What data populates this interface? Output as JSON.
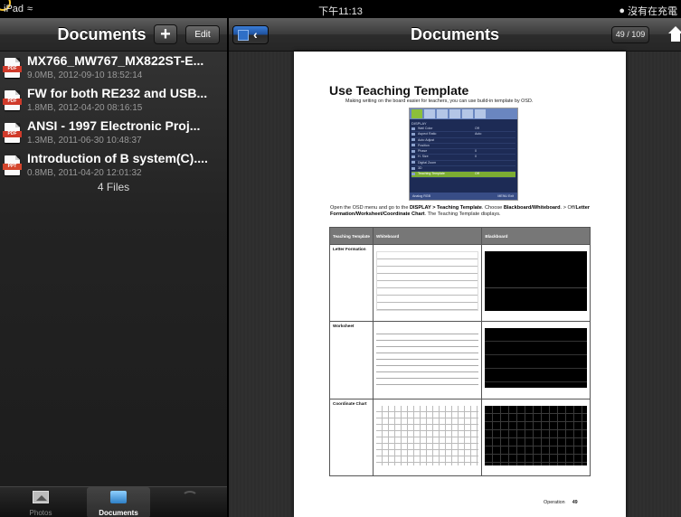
{
  "status_bar": {
    "device": "iPad",
    "time": "下午11:13",
    "battery_text": "沒有在充電"
  },
  "left_panel": {
    "title": "Documents",
    "add_label": "+",
    "edit_label": "Edit",
    "files": [
      {
        "name": "MX766_MW767_MX822ST-E...",
        "meta": "9.0MB, 2012-09-10 18:52:14",
        "type_badge": "PDF",
        "icon": "pdf-file-icon"
      },
      {
        "name": "FW for both RE232 and USB...",
        "meta": "1.8MB, 2012-04-20 08:16:15",
        "type_badge": "PDF",
        "icon": "pdf-file-icon"
      },
      {
        "name": "ANSI - 1997 Electronic Proj...",
        "meta": "1.3MB, 2011-06-30 10:48:37",
        "type_badge": "PDF",
        "icon": "pdf-file-icon"
      },
      {
        "name": "Introduction of B system(C)....",
        "meta": "0.8MB, 2011-04-20 12:01:32",
        "type_badge": "PPT",
        "icon": "ppt-file-icon"
      }
    ],
    "files_count": "4 Files",
    "tabs": [
      {
        "label": "Photos",
        "icon": "photos-icon",
        "active": false
      },
      {
        "label": "Documents",
        "icon": "folder-icon",
        "active": true
      },
      {
        "label": "",
        "icon": "wifi-icon",
        "active": false
      }
    ]
  },
  "viewer": {
    "title": "Documents",
    "back_label": "‹",
    "page_indicator": "49 / 109",
    "home_icon": "home-icon"
  },
  "document": {
    "heading": "Use Teaching Template",
    "intro": "Making writing on the board easier for teachers, you can use build-in template by OSD.",
    "osd": {
      "title": "DISPLAY",
      "rows": [
        {
          "label": "Wall Color",
          "value": "Off"
        },
        {
          "label": "Aspect Ratio",
          "value": "Auto"
        },
        {
          "label": "Auto Adjust",
          "value": ""
        },
        {
          "label": "Position",
          "value": ""
        },
        {
          "label": "Phase",
          "value": "0"
        },
        {
          "label": "H. Size",
          "value": "0"
        },
        {
          "label": "Digital Zoom",
          "value": ""
        },
        {
          "label": "3D",
          "value": ""
        },
        {
          "label": "Teaching Template",
          "value": "Off"
        }
      ],
      "footer_left": "Analog RGB",
      "footer_right": "MENU Exit"
    },
    "description_parts": [
      "Open the OSD menu and go to the ",
      "DISPLAY > Teaching Template",
      ". Choose ",
      "Blackboard/Whiteboard",
      ". > Off/",
      "Letter Formation/Worksheet/Coordinate Chart",
      ". The Teaching Template displays."
    ],
    "table": {
      "headers": [
        "Teaching Template",
        "Whiteboard",
        "Blackboard"
      ],
      "rows": [
        "Letter Formation",
        "Worksheet",
        "Coordinate Chart"
      ]
    },
    "footer_section": "Operation",
    "footer_page": "49"
  }
}
